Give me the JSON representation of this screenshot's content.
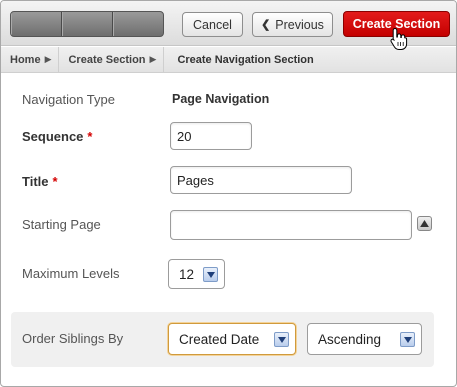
{
  "toolbar": {
    "cancel_label": "Cancel",
    "previous_label": "Previous",
    "create_label": "Create Section",
    "accent_color": "#d40000"
  },
  "breadcrumb": {
    "items": [
      "Home",
      "Create Section",
      "Create Navigation Section"
    ]
  },
  "form": {
    "navigation_type": {
      "label": "Navigation Type",
      "value": "Page Navigation"
    },
    "sequence": {
      "label": "Sequence",
      "required_mark": "*",
      "value": "20"
    },
    "title": {
      "label": "Title",
      "required_mark": "*",
      "value": "Pages"
    },
    "starting_page": {
      "label": "Starting Page",
      "value": ""
    },
    "maximum_levels": {
      "label": "Maximum Levels",
      "selected": "12"
    },
    "order_siblings": {
      "label": "Order Siblings By",
      "order_by_selected": "Created Date",
      "direction_selected": "Ascending"
    }
  }
}
